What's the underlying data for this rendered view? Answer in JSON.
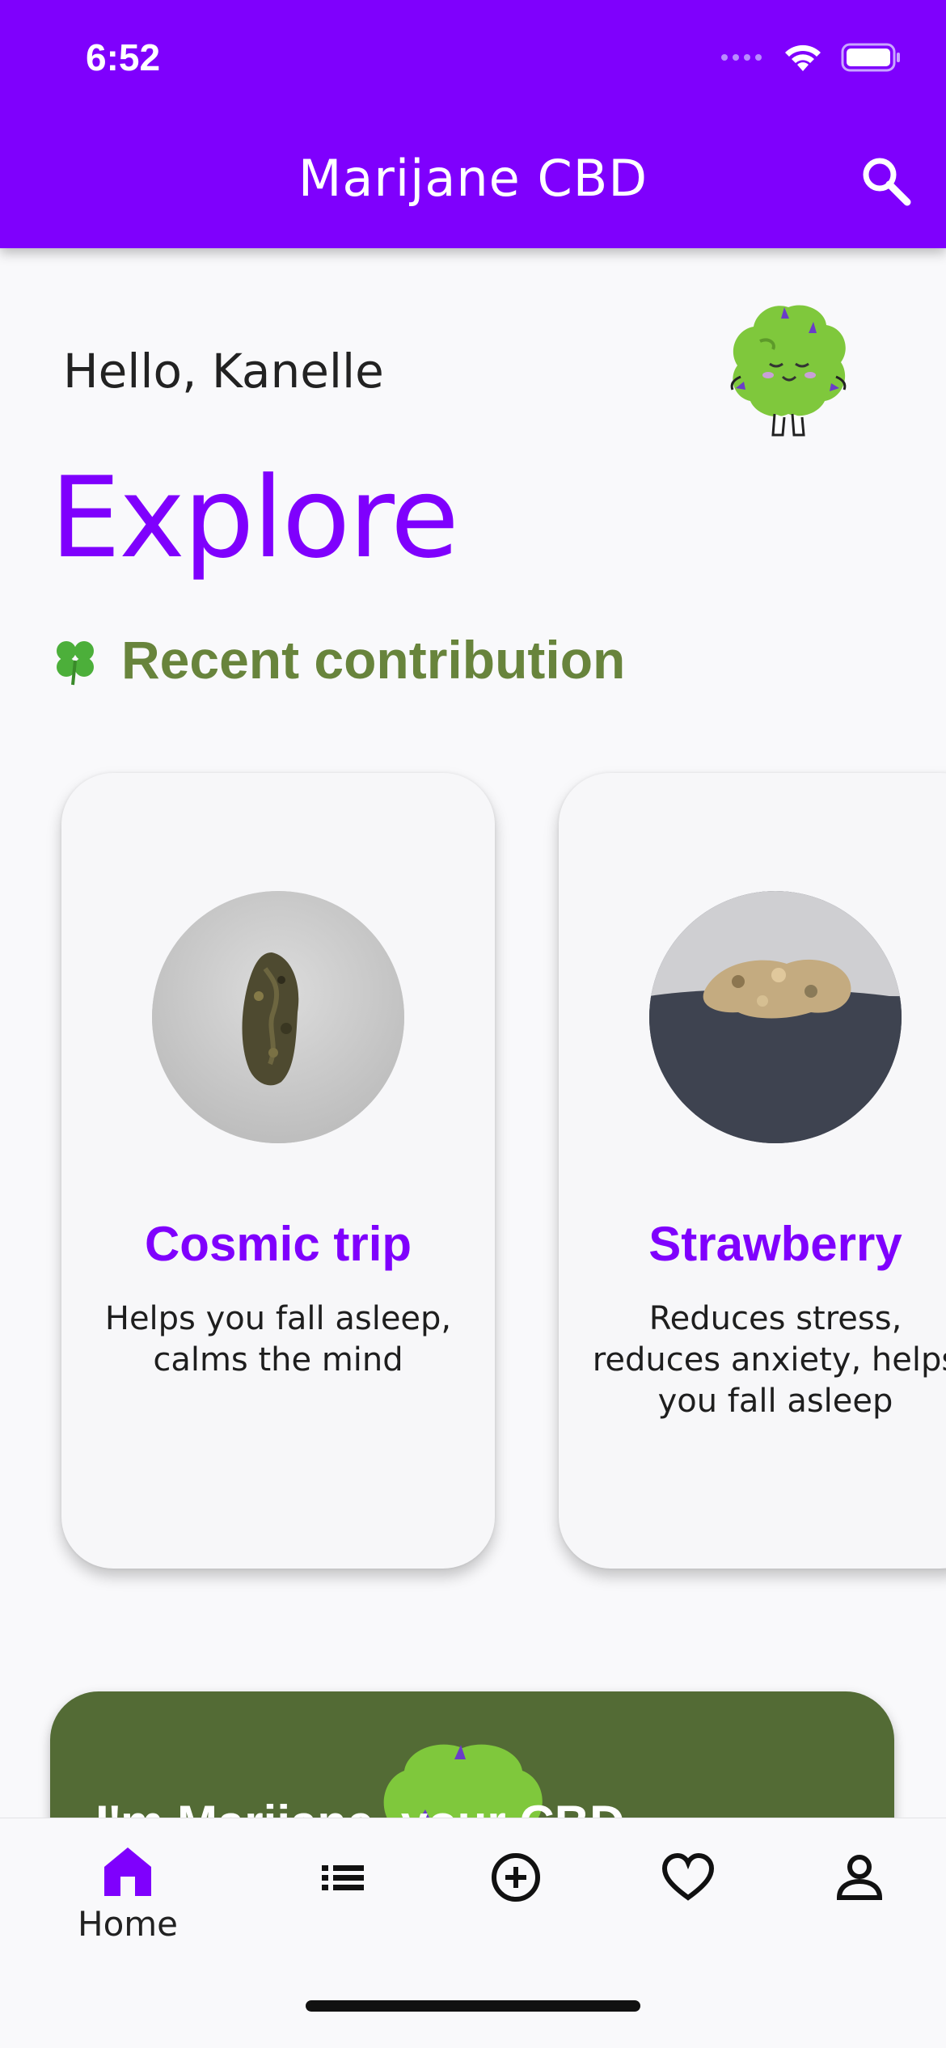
{
  "status_bar": {
    "time": "6:52"
  },
  "app_bar": {
    "title": "Marijane CBD"
  },
  "greeting": "Hello, Kanelle",
  "page_title": "Explore",
  "section": {
    "emoji": "🍀",
    "title": "Recent contribution"
  },
  "cards": [
    {
      "name": "Cosmic trip",
      "description": "Helps you fall asleep,\ncalms the mind"
    },
    {
      "name": "Strawberry",
      "description": "Reduces stress,\nreduces anxiety, helps\nyou fall asleep"
    }
  ],
  "promo": {
    "text": "I'm Marijane, your CBD"
  },
  "bottom_nav": [
    {
      "label": "Home",
      "icon": "home-icon",
      "active": true
    },
    {
      "label": "",
      "icon": "list-icon"
    },
    {
      "label": "",
      "icon": "add-circle-icon"
    },
    {
      "label": "",
      "icon": "heart-icon"
    },
    {
      "label": "",
      "icon": "person-icon"
    }
  ],
  "colors": {
    "primary": "#7f00fd",
    "section_green": "#68843c",
    "promo_green": "#536b35"
  }
}
